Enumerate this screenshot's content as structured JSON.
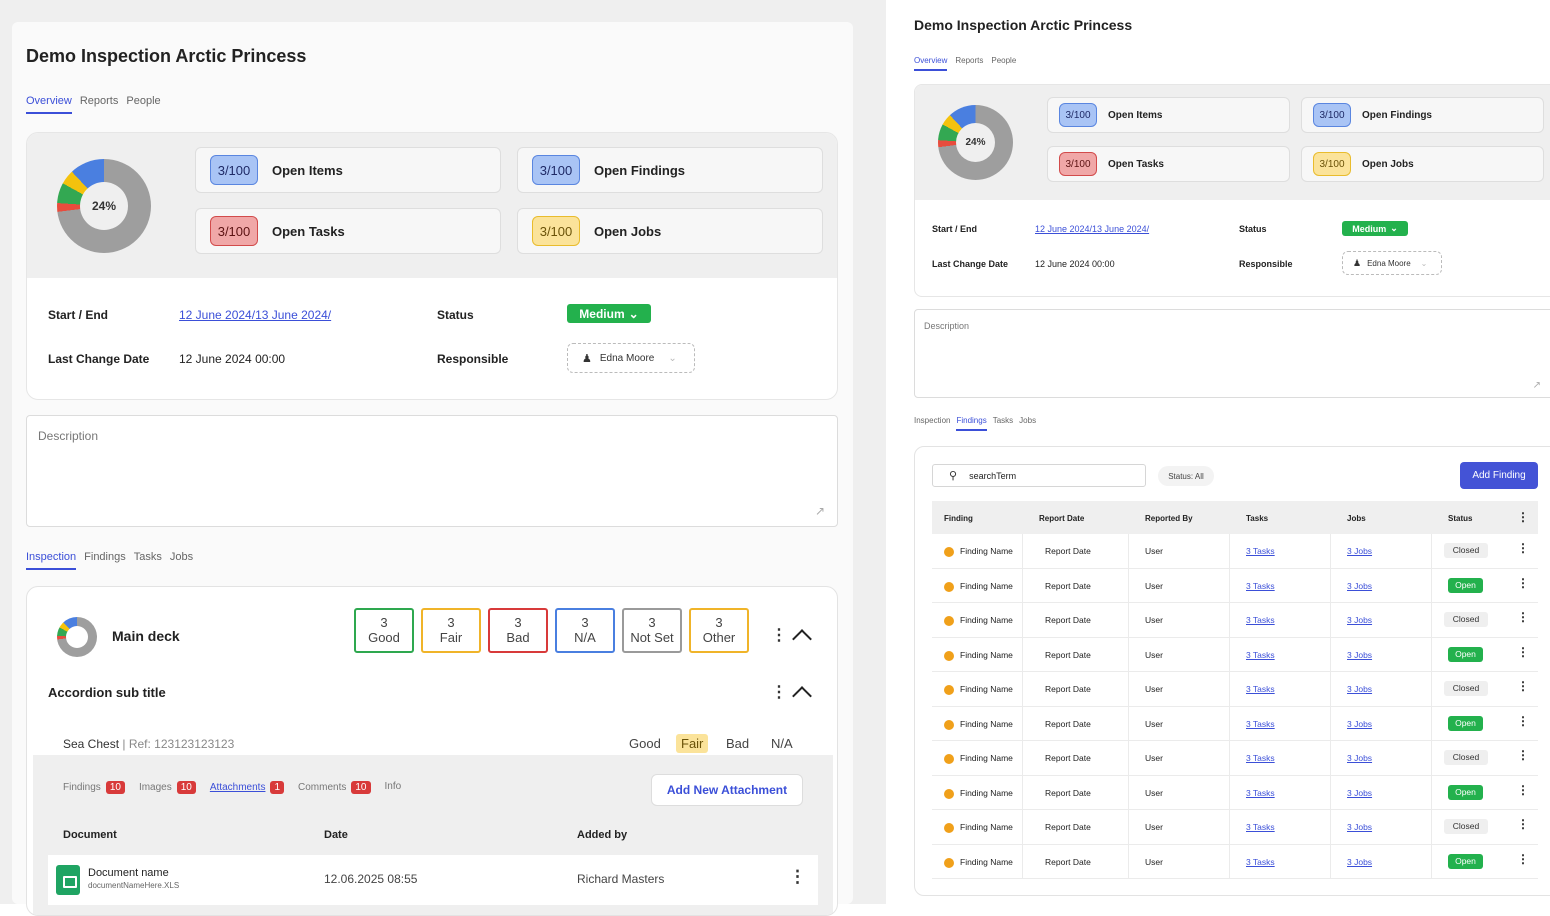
{
  "page": {
    "title": "Demo Inspection Arctic Princess"
  },
  "tabs": [
    "Overview",
    "Reports",
    "People"
  ],
  "summary": {
    "donut_percent": "24%",
    "stats": [
      {
        "badge": "3/100",
        "label": "Open Items",
        "color": "blue"
      },
      {
        "badge": "3/100",
        "label": "Open Findings",
        "color": "blue"
      },
      {
        "badge": "3/100",
        "label": "Open Tasks",
        "color": "red"
      },
      {
        "badge": "3/100",
        "label": "Open Jobs",
        "color": "yellow"
      }
    ]
  },
  "details": {
    "start_end_label": "Start / End",
    "start_end_value": "12 June  2024/13 June  2024/",
    "last_change_label": "Last Change Date",
    "last_change_value": "12 June  2024 00:00",
    "status_label": "Status",
    "status_value": "Medium",
    "responsible_label": "Responsible",
    "responsible_value": "Edna Moore"
  },
  "description_label": "Description",
  "sub_tabs_left": [
    "Inspection",
    "Findings",
    "Tasks",
    "Jobs"
  ],
  "inspection": {
    "section_title": "Main deck",
    "ratings": [
      {
        "count": "3",
        "label": "Good",
        "color": "#2ea84f"
      },
      {
        "count": "3",
        "label": "Fair",
        "color": "#f0b429"
      },
      {
        "count": "3",
        "label": "Bad",
        "color": "#d83a3a"
      },
      {
        "count": "3",
        "label": "N/A",
        "color": "#4a7fe0"
      },
      {
        "count": "3",
        "label": "Not Set",
        "color": "#9a9a9a"
      },
      {
        "count": "3",
        "label": "Other",
        "color": "#f0b429"
      }
    ],
    "sub_title": "Accordion sub title",
    "item_name": "Sea Chest",
    "item_ref": "| Ref: 123123123123",
    "item_options": [
      "Good",
      "Fair",
      "Bad",
      "N/A"
    ],
    "item_tabs": [
      {
        "label": "Findings",
        "count": "10"
      },
      {
        "label": "Images",
        "count": "10"
      },
      {
        "label": "Attachments",
        "count": "1"
      },
      {
        "label": "Comments",
        "count": "10"
      },
      {
        "label": "Info",
        "count": ""
      }
    ],
    "add_attachment": "Add New Attachment",
    "attachment_columns": [
      "Document",
      "Date",
      "Added by"
    ],
    "attachment": {
      "name": "Document name",
      "file": "documentNameHere.XLS",
      "date": "12.06.2025 08:55",
      "added_by": "Richard Masters"
    }
  },
  "right": {
    "sub_tabs": [
      "Inspection",
      "Findings",
      "Tasks",
      "Jobs"
    ],
    "search_value": "searchTerm",
    "filter_label": "Status: All",
    "add_finding": "Add Finding",
    "columns": [
      "Finding",
      "Report Date",
      "Reported By",
      "Tasks",
      "Jobs",
      "Status"
    ],
    "rows": [
      {
        "finding": "Finding Name",
        "date": "Report Date",
        "by": "User",
        "tasks": "3 Tasks",
        "jobs": "3 Jobs",
        "status": "Closed"
      },
      {
        "finding": "Finding Name",
        "date": "Report Date",
        "by": "User",
        "tasks": "3 Tasks",
        "jobs": "3 Jobs",
        "status": "Open"
      },
      {
        "finding": "Finding Name",
        "date": "Report Date",
        "by": "User",
        "tasks": "3 Tasks",
        "jobs": "3 Jobs",
        "status": "Closed"
      },
      {
        "finding": "Finding Name",
        "date": "Report Date",
        "by": "User",
        "tasks": "3 Tasks",
        "jobs": "3 Jobs",
        "status": "Open"
      },
      {
        "finding": "Finding Name",
        "date": "Report Date",
        "by": "User",
        "tasks": "3 Tasks",
        "jobs": "3 Jobs",
        "status": "Closed"
      },
      {
        "finding": "Finding Name",
        "date": "Report Date",
        "by": "User",
        "tasks": "3 Tasks",
        "jobs": "3 Jobs",
        "status": "Open"
      },
      {
        "finding": "Finding Name",
        "date": "Report Date",
        "by": "User",
        "tasks": "3 Tasks",
        "jobs": "3 Jobs",
        "status": "Closed"
      },
      {
        "finding": "Finding Name",
        "date": "Report Date",
        "by": "User",
        "tasks": "3 Tasks",
        "jobs": "3 Jobs",
        "status": "Open"
      },
      {
        "finding": "Finding Name",
        "date": "Report Date",
        "by": "User",
        "tasks": "3 Tasks",
        "jobs": "3 Jobs",
        "status": "Closed"
      },
      {
        "finding": "Finding Name",
        "date": "Report Date",
        "by": "User",
        "tasks": "3 Tasks",
        "jobs": "3 Jobs",
        "status": "Open"
      }
    ]
  }
}
